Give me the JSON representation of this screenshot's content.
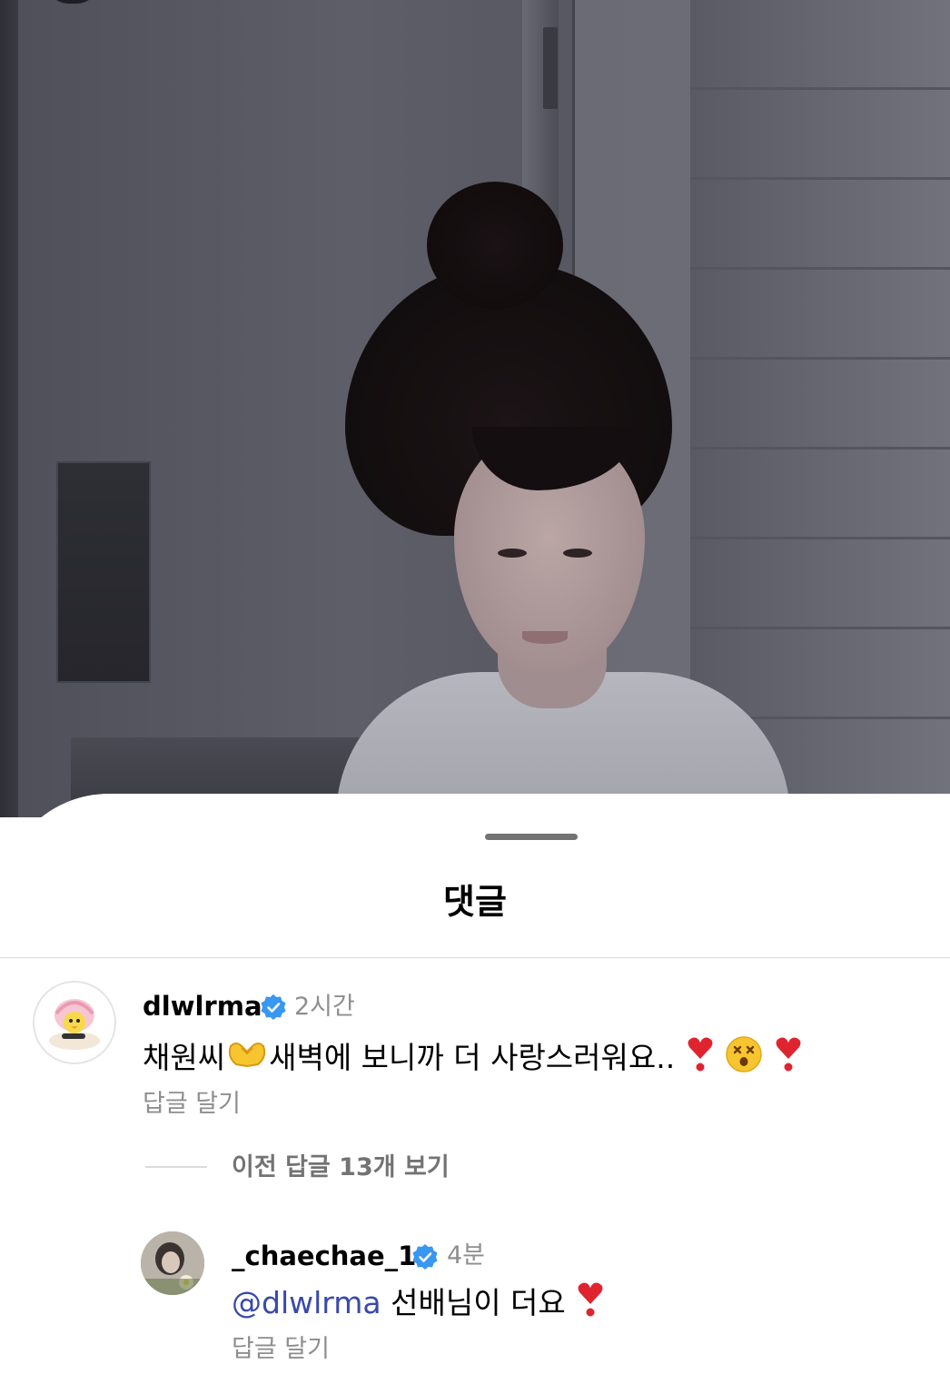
{
  "sheet": {
    "title": "댓글"
  },
  "comments": [
    {
      "username": "dlwlrma",
      "time": "2시간",
      "text_part1": "채원씨",
      "text_part2": "새벽에 보니까 더 사랑스러워요..",
      "reply_label": "답글 달기",
      "avatar_icon": "cartoon-bird-avatar",
      "emojis": [
        "heart-hands-emoji",
        "exclamation-heart-emoji",
        "dizzy-face-emoji",
        "exclamation-heart-emoji"
      ]
    }
  ],
  "replies_toggle": {
    "label": "이전 답글 13개 보기"
  },
  "replies": [
    {
      "username": "_chaechae_1",
      "time": "4분",
      "mention": "@dlwlrma",
      "text": " 선배님이 더요",
      "reply_label": "답글 달기",
      "emojis": [
        "exclamation-heart-emoji"
      ]
    }
  ],
  "colors": {
    "verified": "#3897f0",
    "mention": "#3949ab",
    "muted_text": "#8e8e8e"
  }
}
